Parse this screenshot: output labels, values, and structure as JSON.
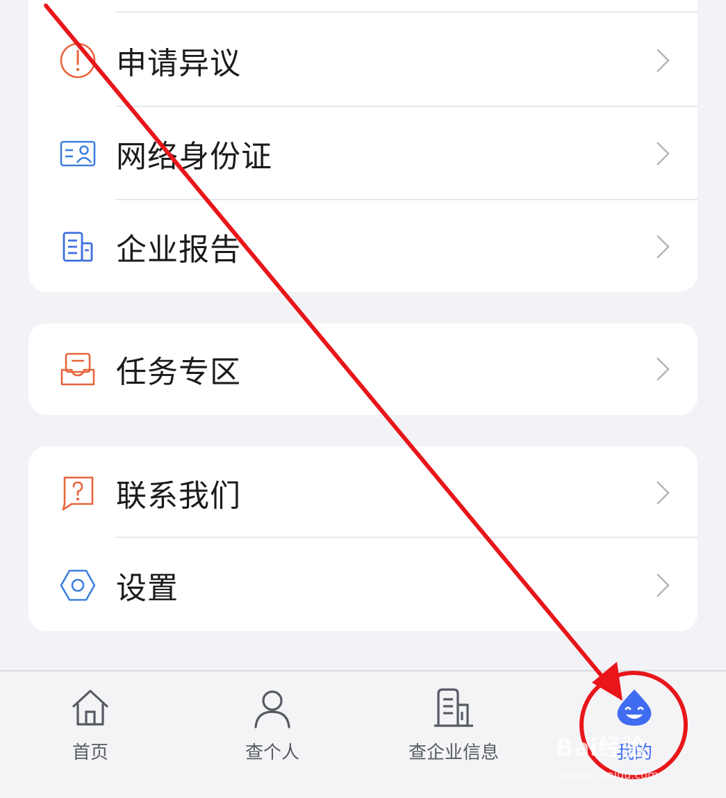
{
  "menu_groups": [
    {
      "items": [
        {
          "label": "申请异议",
          "icon": "alert-circle-icon",
          "icon_color": "#e8643c"
        },
        {
          "label": "网络身份证",
          "icon": "id-card-icon",
          "icon_color": "#3d7fe0"
        },
        {
          "label": "企业报告",
          "icon": "building-report-icon",
          "icon_color": "#3d6fe0"
        }
      ]
    },
    {
      "items": [
        {
          "label": "任务专区",
          "icon": "task-inbox-icon",
          "icon_color": "#e8643c"
        }
      ]
    },
    {
      "items": [
        {
          "label": "联系我们",
          "icon": "question-chat-icon",
          "icon_color": "#e8643c"
        },
        {
          "label": "设置",
          "icon": "hexagon-settings-icon",
          "icon_color": "#3d7fe0"
        }
      ]
    }
  ],
  "tab_bar": {
    "tabs": [
      {
        "label": "首页",
        "icon": "home-icon",
        "active": false
      },
      {
        "label": "查个人",
        "icon": "person-icon",
        "active": false
      },
      {
        "label": "查企业信息",
        "icon": "building-icon",
        "active": false
      },
      {
        "label": "我的",
        "icon": "smiley-drop-icon",
        "active": true
      }
    ]
  },
  "annotation": {
    "arrow_color": "#e8161a",
    "circle_color": "#e8161a"
  },
  "watermark": {
    "text": "Bai经验",
    "subtext": "jingyan.baidu.com"
  },
  "colors": {
    "background": "#f2f3f7",
    "card": "#ffffff",
    "accent": "#3f6cf1"
  }
}
